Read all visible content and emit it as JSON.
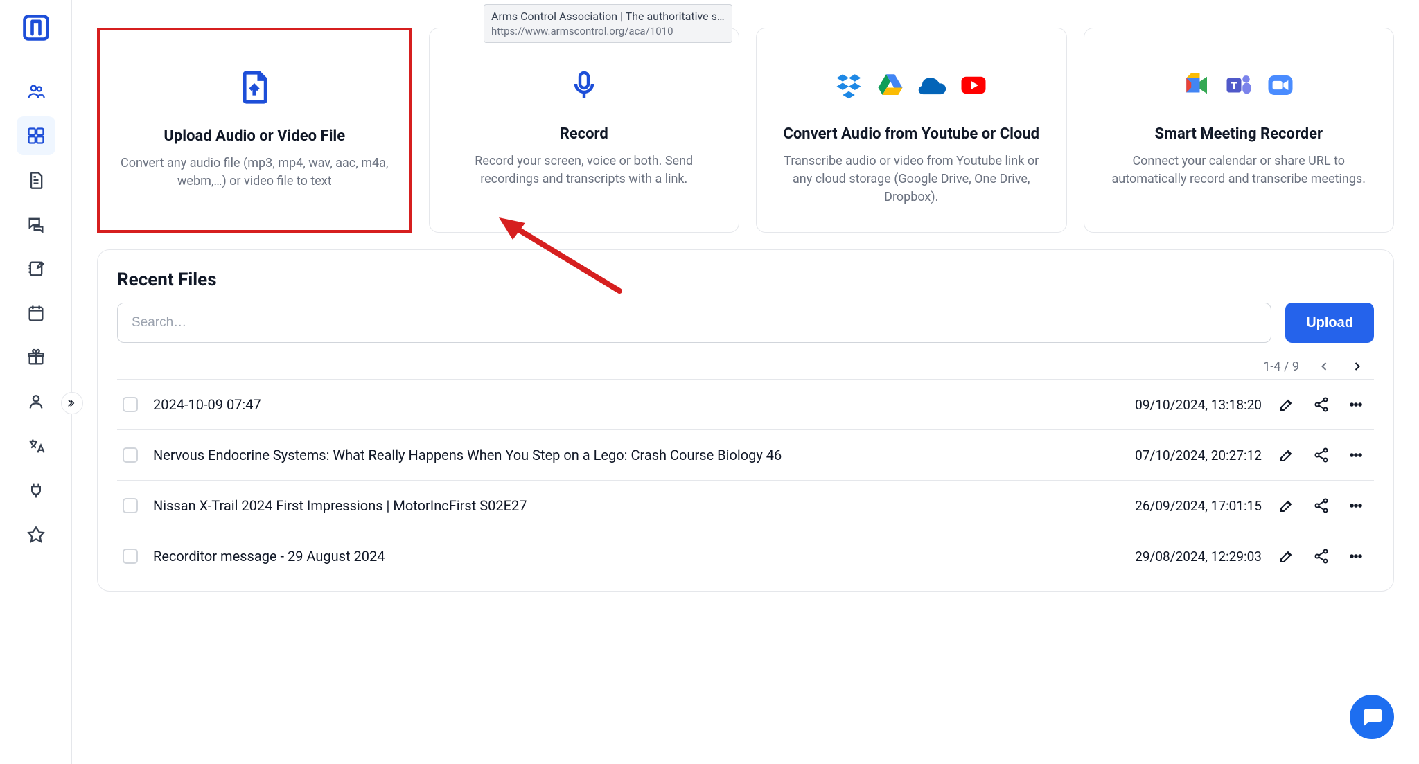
{
  "tooltip": {
    "line1": "Arms Control Association | The authoritative s…",
    "line2": "https://www.armscontrol.org/aca/1010"
  },
  "cards": {
    "upload": {
      "title": "Upload Audio or Video File",
      "desc": "Convert any audio file (mp3, mp4, wav, aac, m4a, webm,…) or video file to text"
    },
    "record": {
      "title": "Record",
      "desc": "Record your screen, voice or both. Send recordings and transcripts with a link."
    },
    "cloud": {
      "title": "Convert Audio from Youtube or Cloud",
      "desc": "Transcribe audio or video from Youtube link or any cloud storage (Google Drive, One Drive, Dropbox)."
    },
    "meeting": {
      "title": "Smart Meeting Recorder",
      "desc": "Connect your calendar or share URL to automatically record and transcribe meetings."
    }
  },
  "recent": {
    "heading": "Recent Files",
    "search_placeholder": "Search…",
    "upload_label": "Upload",
    "pagination": "1-4 / 9",
    "rows": [
      {
        "name": "2024-10-09 07:47",
        "date": "09/10/2024, 13:18:20"
      },
      {
        "name": "Nervous Endocrine Systems: What Really Happens When You Step on a Lego: Crash Course Biology 46",
        "date": "07/10/2024, 20:27:12"
      },
      {
        "name": "Nissan X-Trail 2024 First Impressions | MotorIncFirst S02E27",
        "date": "26/09/2024, 17:01:15"
      },
      {
        "name": "Recorditor message - 29 August 2024",
        "date": "29/08/2024, 12:29:03"
      }
    ]
  }
}
